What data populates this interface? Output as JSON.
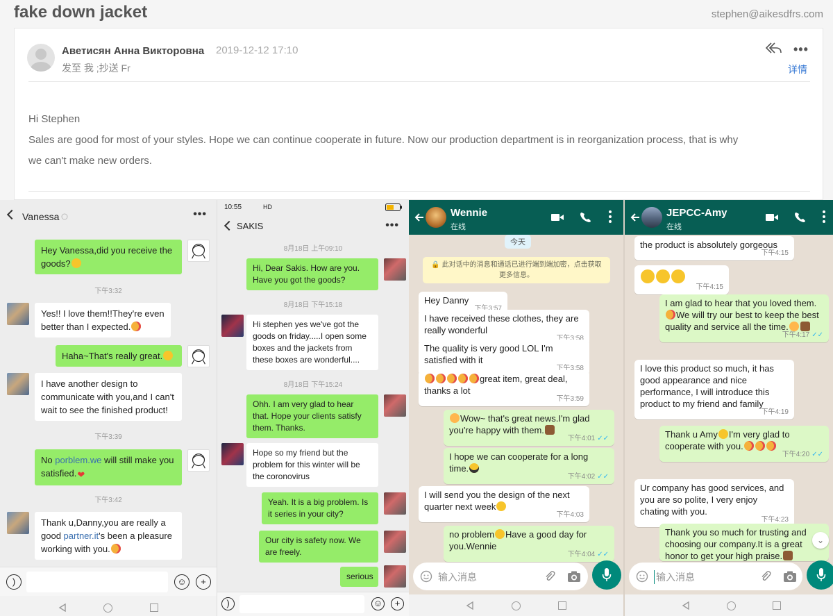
{
  "email": {
    "subject": "fake down jacket",
    "account": "stephen@aikesdfrs.com",
    "sender": "Аветисян Анна Викторовна",
    "date": "2019-12-12 17:10",
    "to_line": "发至 我  ;抄送 Fr",
    "details_link": "详情",
    "greeting": "Hi Stephen",
    "body_line1": "Sales are good for most of your styles. Hope we can continue cooperate in future. Now our production department is in reorganization process, that is why",
    "body_line2": "we can't make new orders."
  },
  "wechat1": {
    "contact": "Vanessa",
    "messages": [
      {
        "dir": "out",
        "text": "Hey Vanessa,did you receive the goods?"
      },
      {
        "sep": "下午3:32"
      },
      {
        "dir": "in",
        "text": "Yes!! I love them!!They're even better than I expected."
      },
      {
        "dir": "out",
        "text": "Haha~That's really great."
      },
      {
        "dir": "in",
        "text": "I have another design to communicate with you,and I can't wait to see the finished product!"
      },
      {
        "sep": "下午3:39"
      },
      {
        "dir": "out",
        "text_a": "No ",
        "link": "porblem.we",
        "text_b": " will still make you satisfied."
      },
      {
        "sep": "下午3:42"
      },
      {
        "dir": "in",
        "text_a": "Thank u,Danny,you are really a good ",
        "link": "partner.it",
        "text_b": "'s been a pleasure working with you."
      }
    ]
  },
  "wechat2": {
    "status_time": "10:55",
    "status_net": "HD",
    "contact": "SAKIS",
    "messages": [
      {
        "sep": "8月18日 上午09:10"
      },
      {
        "dir": "out",
        "text": "Hi, Dear Sakis. How are you. Have you got the goods?"
      },
      {
        "sep": "8月18日 下午15:18"
      },
      {
        "dir": "in",
        "text": "Hi stephen yes we've got the goods on friday.....I open some boxes and the jackets from these boxes are wonderful...."
      },
      {
        "sep": "8月18日 下午15:24"
      },
      {
        "dir": "out",
        "text": "Ohh. I am very glad to hear that. Hope your clients satisfy them. Thanks."
      },
      {
        "dir": "in",
        "text": "Hope so my friend but the problem for this winter will be the coronovirus"
      },
      {
        "dir": "out",
        "text": "Yeah. It is a big problem. Is it series in your city?"
      },
      {
        "dir": "out",
        "text": "Our city is safety now. We are freely."
      },
      {
        "dir": "out",
        "text": "serious"
      }
    ]
  },
  "whatsapp1": {
    "contact": "Wennie",
    "status": "在线",
    "date_chip": "今天",
    "encryption_note": "此对话中的消息和通话已进行端到端加密，点击获取更多信息。",
    "input_placeholder": "输入消息",
    "messages": [
      {
        "dir": "in",
        "text": "Hey Danny",
        "time": "下午3:57"
      },
      {
        "dir": "in",
        "text": "I have received these clothes, they are really wonderful",
        "time": "下午3:58"
      },
      {
        "dir": "in",
        "text": "The quality is very good LOL I'm satisfied with it",
        "time": "下午3:58"
      },
      {
        "dir": "in",
        "text": "great item, great deal, thanks a lot",
        "time": "下午3:59"
      },
      {
        "dir": "out",
        "text": "Wow~ that's great news.I'm glad you're happy with them.",
        "time": "下午4:01"
      },
      {
        "dir": "out",
        "text": "I hope we can cooperate for a long time.",
        "time": "下午4:02"
      },
      {
        "dir": "in",
        "text": "I will send you the design of the next quarter next week",
        "time": "下午4:03"
      },
      {
        "dir": "out",
        "text_a": "no problem",
        "text_b": "Have a good day for you.Wennie",
        "time": "下午4:04"
      }
    ]
  },
  "whatsapp2": {
    "contact": "JEPCC-Amy",
    "status": "在线",
    "input_placeholder": "输入消息",
    "messages": [
      {
        "dir": "in",
        "text": "the product is absolutely gorgeous",
        "time": "下午4:15"
      },
      {
        "dir": "in",
        "text": "",
        "time": "下午4:15"
      },
      {
        "dir": "out",
        "text_a": "I am glad to hear that you loved them.",
        "text_b": "We will try our best to keep the best quality and service all the time.",
        "time": "下午4:17"
      },
      {
        "dir": "in",
        "text": "I love this product so much, it has good appearance and nice performance, I will introduce this product to my friend and family",
        "time": "下午4:19"
      },
      {
        "dir": "out",
        "text_a": "Thank u Amy",
        "text_b": "I'm very glad to cooperate with you.",
        "time": "下午4:20"
      },
      {
        "dir": "in",
        "text": "Ur company has good services, and you are so polite, I very enjoy chating with you.",
        "time": "下午4:23"
      },
      {
        "dir": "out",
        "text": "Thank you so much for trusting and choosing our company.It is a great honor to get your high praise."
      }
    ]
  }
}
